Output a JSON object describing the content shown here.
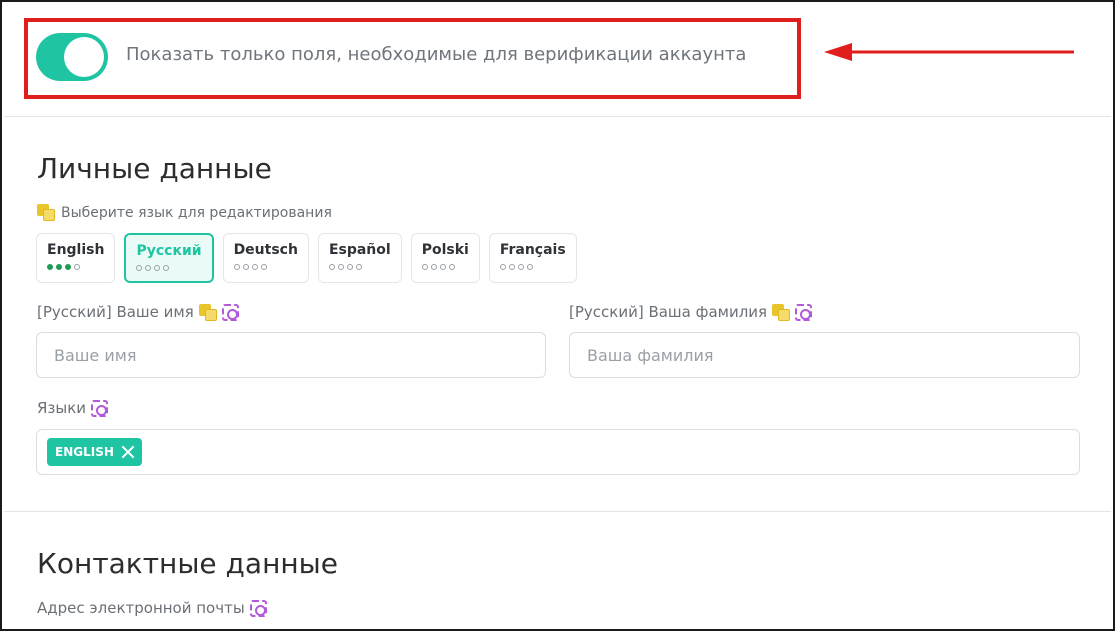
{
  "verification_toggle": {
    "label": "Показать только поля, необходимые для верификации аккаунта",
    "state": "on"
  },
  "personal": {
    "title": "Личные данные",
    "language_hint": "Выберите язык для редактирования",
    "languages": [
      {
        "name": "English",
        "filled": 3
      },
      {
        "name": "Русский",
        "filled": 0,
        "active": true
      },
      {
        "name": "Deutsch",
        "filled": 0
      },
      {
        "name": "Español",
        "filled": 0
      },
      {
        "name": "Polski",
        "filled": 0
      },
      {
        "name": "Français",
        "filled": 0
      }
    ],
    "first_name": {
      "label": "[Русский] Ваше имя",
      "placeholder": "Ваше имя",
      "value": ""
    },
    "last_name": {
      "label": "[Русский] Ваша фамилия",
      "placeholder": "Ваша фамилия",
      "value": ""
    },
    "spoken_languages": {
      "label": "Языки",
      "chips": [
        "ENGLISH"
      ]
    }
  },
  "contacts": {
    "title": "Контактные данные",
    "email_label": "Адрес электронной почты"
  },
  "colors": {
    "accent": "#1fc4a3",
    "highlight": "#e01e1e",
    "progress_dot": "#1f9c55"
  }
}
